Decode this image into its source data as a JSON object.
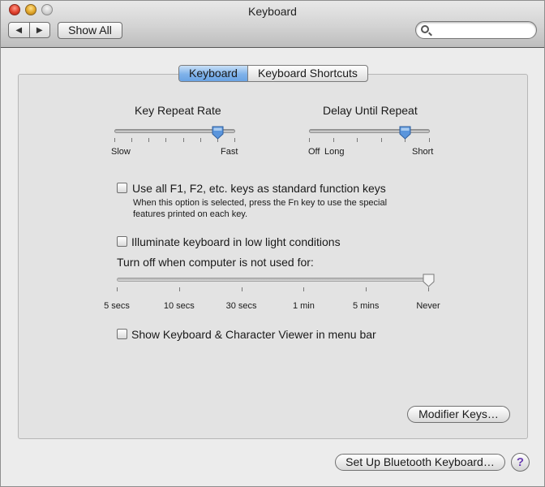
{
  "window": {
    "title": "Keyboard"
  },
  "toolbar": {
    "back_glyph": "◀",
    "forward_glyph": "▶",
    "show_all_label": "Show All",
    "search": {
      "value": "",
      "placeholder": ""
    }
  },
  "tabs": [
    {
      "label": "Keyboard",
      "active": true
    },
    {
      "label": "Keyboard Shortcuts",
      "active": false
    }
  ],
  "key_repeat": {
    "title": "Key Repeat Rate",
    "min_label": "Slow",
    "max_label": "Fast",
    "tick_count": 8,
    "selected_index": 6
  },
  "delay_repeat": {
    "title": "Delay Until Repeat",
    "labels": [
      "Off",
      "Long",
      "Short"
    ],
    "tick_count": 6,
    "selected_index": 4
  },
  "function_keys": {
    "label": "Use all F1, F2, etc. keys as standard function keys",
    "checked": false,
    "description_line1": "When this option is selected, press the Fn key to use the special",
    "description_line2": "features printed on each key."
  },
  "illuminate": {
    "label": "Illuminate keyboard in low light conditions",
    "checked": false,
    "turn_off_label": "Turn off when computer is not used for:",
    "stops": [
      "5 secs",
      "10 secs",
      "30 secs",
      "1 min",
      "5 mins",
      "Never"
    ],
    "selected": "Never"
  },
  "viewer": {
    "label": "Show Keyboard & Character Viewer in menu bar",
    "checked": false
  },
  "buttons": {
    "modifier_keys": "Modifier Keys…",
    "bluetooth": "Set Up Bluetooth Keyboard…",
    "help": "?"
  },
  "colors": {
    "tab_active": "#7fb2ea",
    "knob_blue": "#5a95dc",
    "help_purple": "#6b3fb3"
  }
}
